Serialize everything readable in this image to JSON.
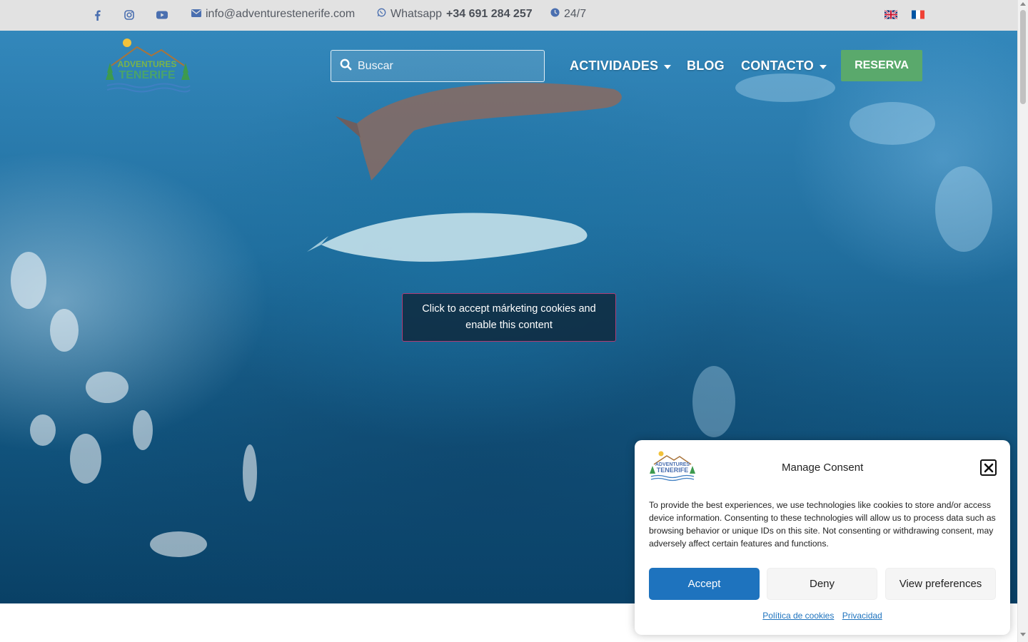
{
  "topbar": {
    "social_icons": [
      "facebook-icon",
      "instagram-icon",
      "youtube-icon"
    ],
    "email": "info@adventurestenerife.com",
    "whatsapp_label": "Whatsapp",
    "whatsapp_number": "+34 691 284 257",
    "hours": "24/7",
    "languages": [
      "English",
      "Français"
    ]
  },
  "header": {
    "logo_top": "ADVENTURES",
    "logo_bottom": "TENERIFE",
    "search_placeholder": "Buscar",
    "nav": {
      "activities": "ACTIVIDADES",
      "blog": "BLOG",
      "contact": "CONTACTO"
    },
    "cta": "RESERVA"
  },
  "hero": {
    "blocked_content_message": "Click to accept márketing cookies and enable this content"
  },
  "consent": {
    "title": "Manage Consent",
    "body": "To provide the best experiences, we use technologies like cookies to store and/or access device information. Consenting to these technologies will allow us to process data such as browsing behavior or unique IDs on this site. Not consenting or withdrawing consent, may adversely affect certain features and functions.",
    "accept": "Accept",
    "deny": "Deny",
    "view_preferences": "View preferences",
    "cookie_policy_link": "Política de cookies",
    "privacy_link": "Privacidad"
  },
  "colors": {
    "topbar_bg": "#e2e2e2",
    "cta_green": "#5aa96c",
    "accept_blue": "#1e73be",
    "hero_blue": "#1a6fa3"
  }
}
